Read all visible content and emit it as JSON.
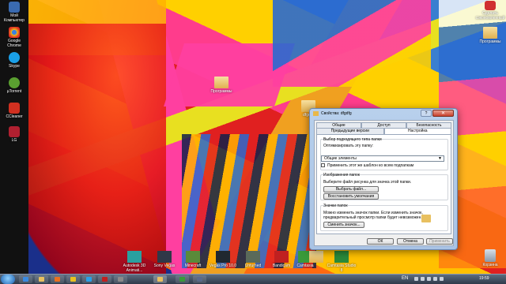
{
  "desktop": {
    "left_icons": [
      {
        "label": "Мой Компьютер",
        "icon": "computer-icon",
        "color": "#3a6ab0"
      },
      {
        "label": "Google Chrome",
        "icon": "chrome-icon",
        "color": "#e8c020"
      },
      {
        "label": "Skype",
        "icon": "skype-icon",
        "color": "#1aa0e8"
      },
      {
        "label": "µTorrent",
        "icon": "utorrent-icon",
        "color": "#5aa030"
      },
      {
        "label": "CCleaner",
        "icon": "ccleaner-icon",
        "color": "#d03020"
      },
      {
        "label": "LG",
        "icon": "app-icon",
        "color": "#b02030"
      }
    ],
    "center_icon": {
      "label": "Программы",
      "icon": "folder-icon"
    },
    "dialog_folder_icon": {
      "label": "dfgdfg",
      "icon": "folder-icon"
    },
    "top_right_icon": {
      "label": "Сделать сэкономленный",
      "icon": "shutdown-icon",
      "color": "#d03030"
    },
    "right_folder_icon": {
      "label": "Программы",
      "icon": "folder-icon"
    },
    "recycle_icon": {
      "label": "Корзина",
      "icon": "recycle-bin-icon"
    },
    "bottom_icons": [
      {
        "label": "Autodesk 3D Animati...",
        "icon": "maya-icon"
      },
      {
        "label": "Sony Vegas",
        "icon": "vegas-icon"
      },
      {
        "label": "Minecraft",
        "icon": "minecraft-icon"
      },
      {
        "label": "Vegas Pro 10.0",
        "icon": "vegas-pro-icon"
      },
      {
        "label": "Unturned",
        "icon": "unturned-icon"
      },
      {
        "label": "Bandicam",
        "icon": "bandicam-icon"
      },
      {
        "label": "Camtasia",
        "icon": "camtasia-icon"
      },
      {
        "label": "",
        "icon": "folder-icon"
      },
      {
        "label": "Camtasia Studio 8",
        "icon": "camtasia8-icon"
      }
    ]
  },
  "dialog": {
    "title": "Свойства: dfgdfg",
    "help_label": "?",
    "close_label": "✕",
    "tabs_row1": [
      "Общие",
      "Доступ",
      "Безопасность"
    ],
    "tabs_row2": [
      "Предыдущие версии",
      "Настройка"
    ],
    "group1": {
      "title": "Выбор подходящего типа папки",
      "optimize_label": "Оптимизировать эту папку:",
      "select_value": "Общие элементы",
      "checkbox_label": "Применить этот же шаблон ко всем подпапкам"
    },
    "group2": {
      "title": "Изображения папок",
      "desc": "Выберите файл рисунка для значка этой папки.",
      "choose_button": "Выбрать файл...",
      "restore_button": "Восстановить умолчания"
    },
    "group3": {
      "title": "Значки папок",
      "desc1": "Можно изменить значок папки. Если изменить значок,",
      "desc2": "предварительный просмотр папки будет невозможен.",
      "change_button": "Сменить значок..."
    },
    "ok_button": "ОК",
    "cancel_button": "Отмена",
    "apply_button": "Применить"
  },
  "taskbar": {
    "lang": "EN",
    "clock": "19:59",
    "start_label": "Start"
  }
}
